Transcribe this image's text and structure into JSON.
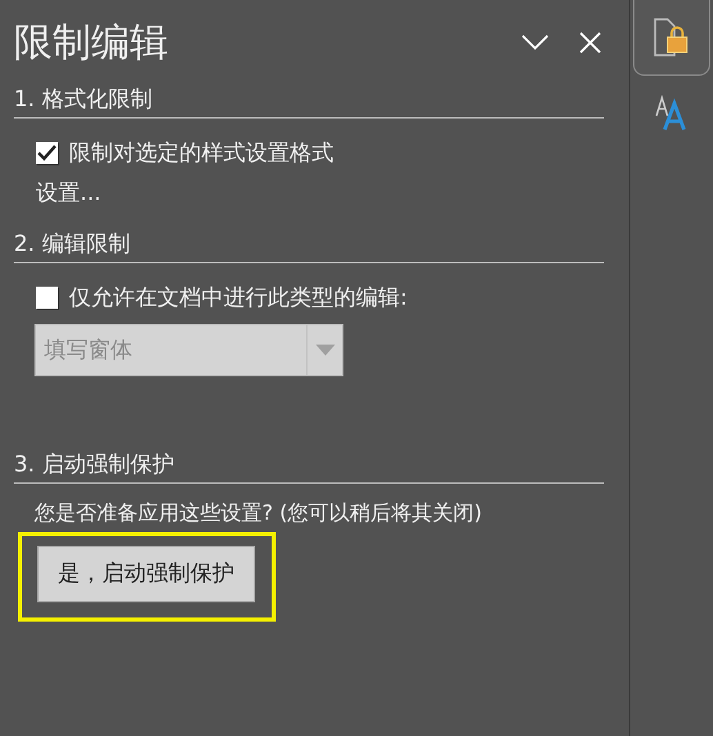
{
  "pane": {
    "title": "限制编辑"
  },
  "sections": [
    {
      "heading": "1. 格式化限制",
      "items": [
        {
          "kind": "checkbox",
          "label": "限制对选定的样式设置格式",
          "checked": true
        },
        {
          "kind": "link",
          "label": "设置..."
        }
      ]
    },
    {
      "heading": "2. 编辑限制",
      "items": [
        {
          "kind": "checkbox",
          "label": "仅允许在文档中进行此类型的编辑:",
          "checked": false
        },
        {
          "kind": "dropdown",
          "value": "填写窗体",
          "disabled": true
        }
      ]
    },
    {
      "heading": "3. 启动强制保护",
      "items": [
        {
          "kind": "text",
          "label": "您是否准备应用这些设置? (您可以稍后将其关闭)"
        },
        {
          "kind": "button",
          "label": "是，启动强制保护",
          "highlighted": true
        }
      ]
    }
  ],
  "side_tabs": [
    {
      "kind": "restrict",
      "selected": true
    },
    {
      "kind": "styles",
      "selected": false
    }
  ]
}
